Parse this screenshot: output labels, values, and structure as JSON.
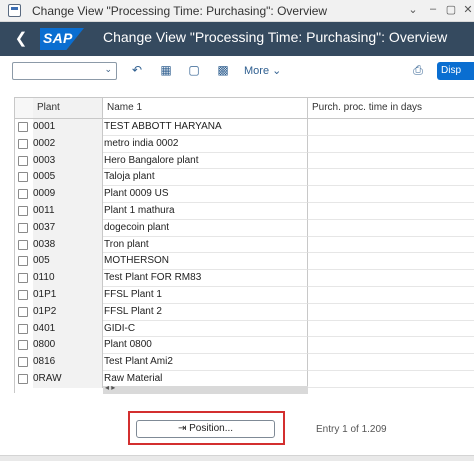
{
  "window": {
    "title": "Change View \"Processing Time: Purchasing\": Overview",
    "controls": [
      "⌄",
      "–",
      "▢",
      "✕"
    ]
  },
  "shell": {
    "logo": "SAP",
    "title": "Change View \"Processing Time: Purchasing\": Overview",
    "brand_color": "#354a5f",
    "accent_color": "#0a6ed1"
  },
  "toolbar": {
    "select_value": "",
    "more_label": "More",
    "display_label": "Disp",
    "icons": [
      "undo-icon",
      "select-all-icon",
      "deselect-all-icon",
      "print-icon"
    ]
  },
  "table": {
    "columns": [
      "Plant",
      "Name 1",
      "Purch. proc. time in days"
    ],
    "rows": [
      {
        "plant": "0001",
        "name": "TEST ABBOTT HARYANA",
        "time": ""
      },
      {
        "plant": "0002",
        "name": "metro india 0002",
        "time": ""
      },
      {
        "plant": "0003",
        "name": "Hero Bangalore plant",
        "time": ""
      },
      {
        "plant": "0005",
        "name": "Taloja plant",
        "time": ""
      },
      {
        "plant": "0009",
        "name": "Plant 0009 US",
        "time": ""
      },
      {
        "plant": "0011",
        "name": "Plant 1 mathura",
        "time": ""
      },
      {
        "plant": "0037",
        "name": "dogecoin plant",
        "time": ""
      },
      {
        "plant": "0038",
        "name": "Tron plant",
        "time": ""
      },
      {
        "plant": "005",
        "name": "MOTHERSON",
        "time": ""
      },
      {
        "plant": "0110",
        "name": "Test Plant FOR RM83",
        "time": ""
      },
      {
        "plant": "01P1",
        "name": "FFSL Plant 1",
        "time": ""
      },
      {
        "plant": "01P2",
        "name": "FFSL Plant 2",
        "time": ""
      },
      {
        "plant": "0401",
        "name": "GIDI-C",
        "time": ""
      },
      {
        "plant": "0800",
        "name": "Plant 0800",
        "time": ""
      },
      {
        "plant": "0816",
        "name": "Test Plant Ami2",
        "time": ""
      },
      {
        "plant": "0RAW",
        "name": "Raw Material",
        "time": ""
      }
    ]
  },
  "footer": {
    "position_label": "Position...",
    "entry_text": "Entry 1 of 1.209"
  }
}
